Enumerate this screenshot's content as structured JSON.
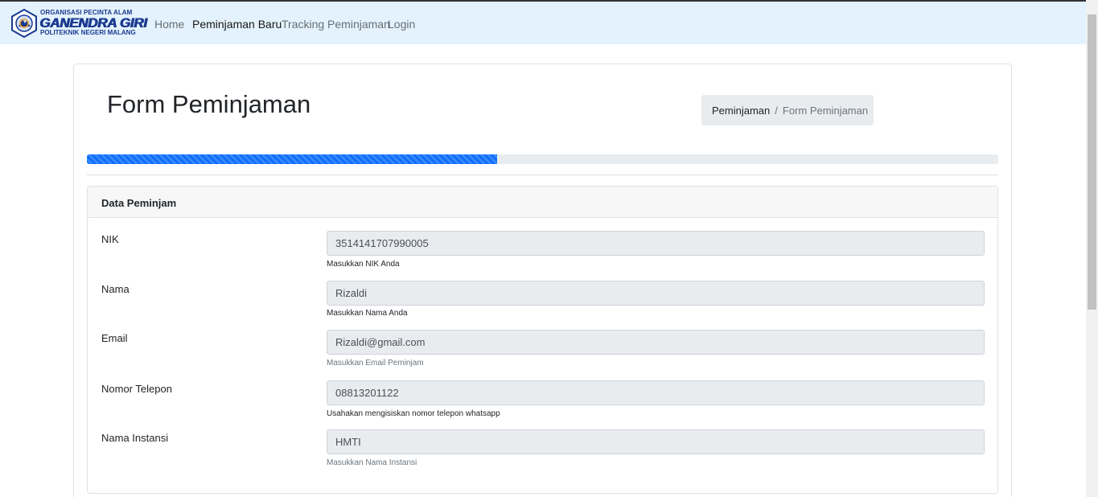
{
  "brand": {
    "line1": "ORGANISASI PECINTA ALAM",
    "line2": "GANENDRA GIRI",
    "line3": "POLITEKNIK NEGERI MALANG"
  },
  "nav": {
    "items": [
      {
        "label": "Home",
        "active": false
      },
      {
        "label": "Peminjaman Baru",
        "active": true
      },
      {
        "label": "Tracking Peminjaman",
        "active": false
      },
      {
        "label": "Login",
        "active": false
      }
    ]
  },
  "page": {
    "title": "Form Peminjaman",
    "breadcrumb": [
      "Peminjaman",
      "Form Peminjaman"
    ],
    "progress_fraction": 0.45
  },
  "section": {
    "title": "Data Peminjam",
    "fields": [
      {
        "label": "NIK",
        "value": "3514141707990005",
        "help": "Masukkan NIK Anda"
      },
      {
        "label": "Nama",
        "value": "Rizaldi",
        "help": "Masukkan Nama Anda"
      },
      {
        "label": "Email",
        "value": "Rizaldi@gmail.com",
        "help": "Masukkan Email Peminjam"
      },
      {
        "label": "Nomor Telepon",
        "value": "08813201122",
        "help": "Usahakan mengisiskan nomor telepon whatsapp"
      },
      {
        "label": "Nama Instansi",
        "value": "HMTI",
        "help": "Masukkan Nama Instansi"
      }
    ]
  },
  "colors": {
    "navbar_bg": "#e3f2fd",
    "progress": "#0d6efd",
    "brand": "#1b3a8f"
  }
}
